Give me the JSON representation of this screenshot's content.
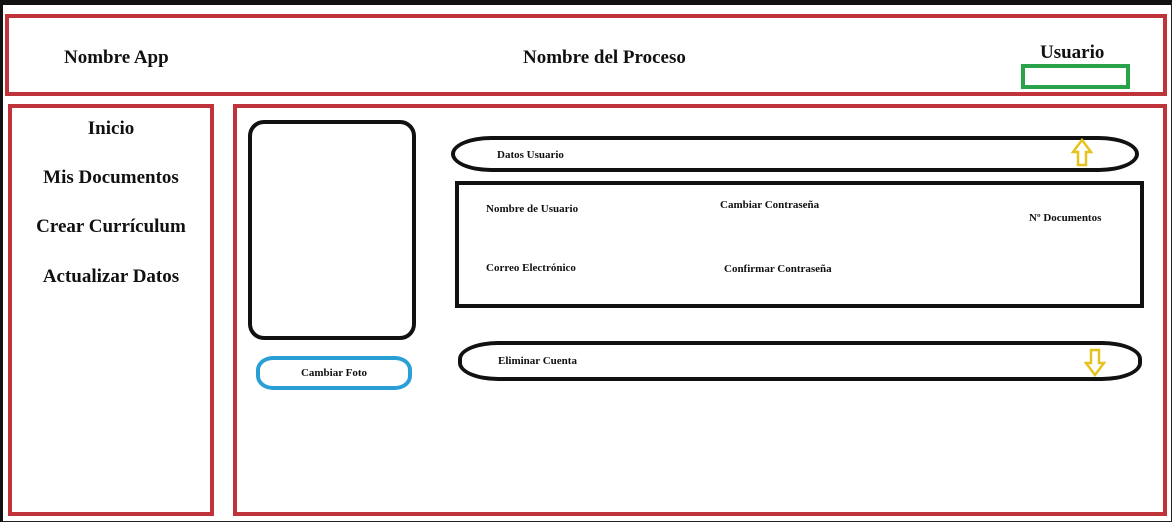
{
  "header": {
    "app_name": "Nombre App",
    "process_name": "Nombre del Proceso",
    "user_label": "Usuario"
  },
  "sidebar": {
    "items": [
      {
        "label": "Inicio"
      },
      {
        "label": "Mis Documentos"
      },
      {
        "label": "Crear Currículum"
      },
      {
        "label": "Actualizar Datos"
      }
    ]
  },
  "profile": {
    "change_photo_label": "Cambiar Foto"
  },
  "user_data": {
    "section_label": "Datos Usuario",
    "username_label": "Nombre de Usuario",
    "change_password_label": "Cambiar Contraseña",
    "documents_count_label": "Nº Documentos",
    "email_label": "Correo Electrónico",
    "confirm_password_label": "Confirmar Contraseña"
  },
  "account": {
    "delete_label": "Eliminar Cuenta"
  },
  "icons": {
    "collapse": "arrow-up-icon",
    "expand": "arrow-down-icon"
  },
  "colors": {
    "region_border": "#c0333a",
    "user_box_border": "#2aa24a",
    "photo_button_border": "#2a9fd6",
    "arrow": "#e6c21f"
  }
}
